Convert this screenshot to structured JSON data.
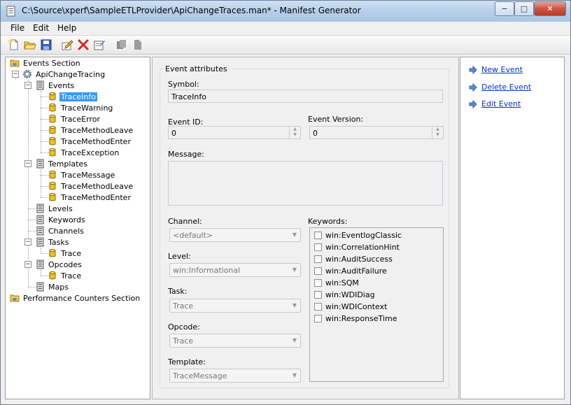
{
  "window": {
    "title": "C:\\Source\\xperf\\SampleETLProvider\\ApiChangeTraces.man* - Manifest Generator",
    "minimize": "−",
    "maximize": "□",
    "close": "✕"
  },
  "menu": [
    "File",
    "Edit",
    "Help"
  ],
  "toolbar": [
    "new-icon",
    "open-icon",
    "save-icon",
    "edit-icon",
    "delete-icon",
    "properties-icon",
    "copy-icon",
    "paste-icon"
  ],
  "tree": {
    "events_section": "Events Section",
    "provider": "ApiChangeTracing",
    "events": "Events",
    "event_items": [
      "TraceInfo",
      "TraceWarning",
      "TraceError",
      "TraceMethodLeave",
      "TraceMethodEnter",
      "TraceException"
    ],
    "templates": "Templates",
    "template_items": [
      "TraceMessage",
      "TraceMethodLeave",
      "TraceMethodEnter"
    ],
    "levels": "Levels",
    "keywords": "Keywords",
    "channels": "Channels",
    "tasks": "Tasks",
    "task_items": [
      "Trace"
    ],
    "opcodes": "Opcodes",
    "opcode_items": [
      "Trace"
    ],
    "maps": "Maps",
    "perf_section": "Performance Counters Section"
  },
  "form": {
    "group_title": "Event attributes",
    "symbol_label": "Symbol:",
    "symbol_value": "TraceInfo",
    "event_id_label": "Event ID:",
    "event_id_value": "0",
    "event_version_label": "Event Version:",
    "event_version_value": "0",
    "message_label": "Message:",
    "message_value": "",
    "channel_label": "Channel:",
    "channel_value": "<default>",
    "level_label": "Level:",
    "level_value": "win:Informational",
    "task_label": "Task:",
    "task_value": "Trace",
    "opcode_label": "Opcode:",
    "opcode_value": "Trace",
    "template_label": "Template:",
    "template_value": "TraceMessage",
    "keywords_label": "Keywords:",
    "keywords": [
      "win:EventlogClassic",
      "win:CorrelationHint",
      "win:AuditSuccess",
      "win:AuditFailure",
      "win:SQM",
      "win:WDIDiag",
      "win:WDIContext",
      "win:ResponseTime"
    ]
  },
  "actions": [
    "New Event",
    "Delete Event",
    "Edit Event"
  ],
  "colors": {
    "selection": "#3399ff",
    "link": "#0033cc",
    "close_button": "#c85543"
  }
}
